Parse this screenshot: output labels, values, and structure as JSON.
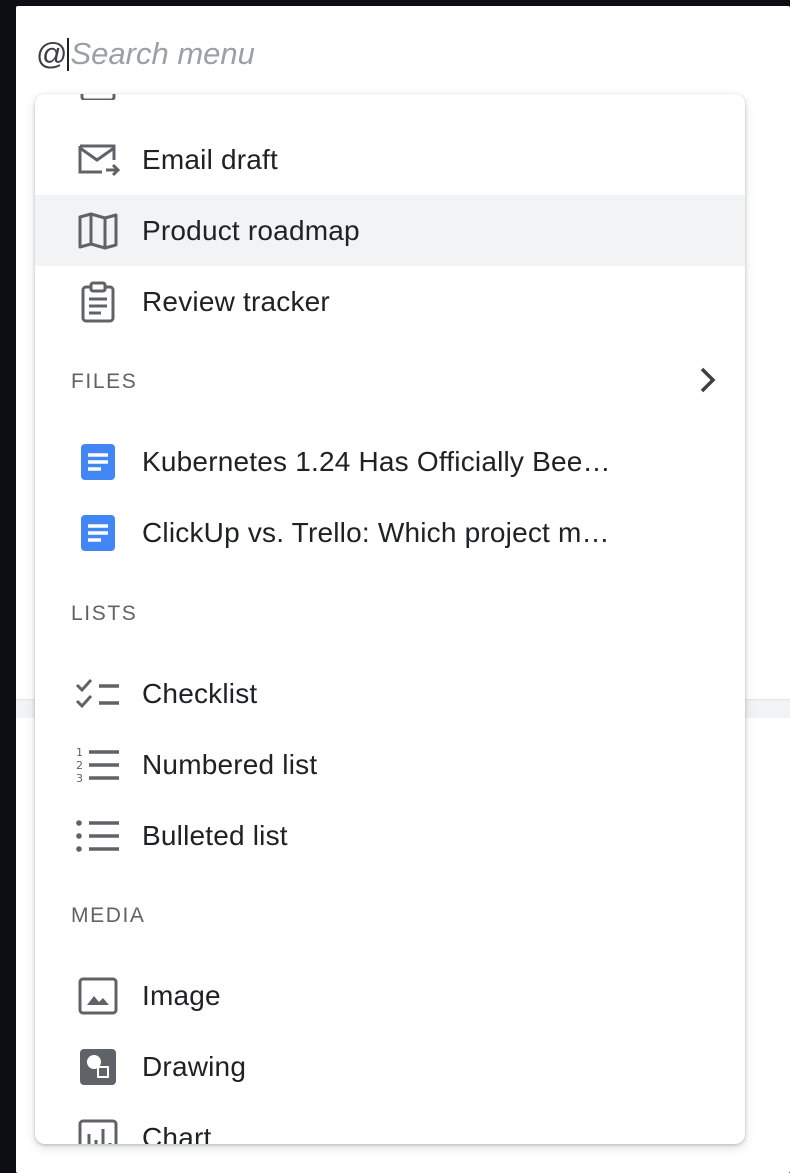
{
  "search": {
    "prefix": "@",
    "placeholder": "Search menu"
  },
  "colors": {
    "doc_blue": "#4285f4",
    "icon_gray": "#5f6368",
    "highlight": "#f1f3f4"
  },
  "menu": {
    "top_items": [
      {
        "label": "Email draft",
        "icon": "email-draft-icon"
      },
      {
        "label": "Product roadmap",
        "icon": "map-icon",
        "highlighted": true
      },
      {
        "label": "Review tracker",
        "icon": "clipboard-icon"
      }
    ],
    "sections": {
      "files": {
        "title": "FILES",
        "items": [
          {
            "label": "Kubernetes 1.24 Has Officially Bee…",
            "icon": "google-doc-icon"
          },
          {
            "label": "ClickUp vs. Trello: Which project m…",
            "icon": "google-doc-icon"
          }
        ]
      },
      "lists": {
        "title": "LISTS",
        "items": [
          {
            "label": "Checklist",
            "icon": "checklist-icon"
          },
          {
            "label": "Numbered list",
            "icon": "numbered-list-icon"
          },
          {
            "label": "Bulleted list",
            "icon": "bulleted-list-icon"
          }
        ]
      },
      "media": {
        "title": "MEDIA",
        "items": [
          {
            "label": "Image",
            "icon": "image-icon"
          },
          {
            "label": "Drawing",
            "icon": "drawing-icon"
          },
          {
            "label": "Chart",
            "icon": "chart-icon"
          }
        ]
      }
    }
  }
}
